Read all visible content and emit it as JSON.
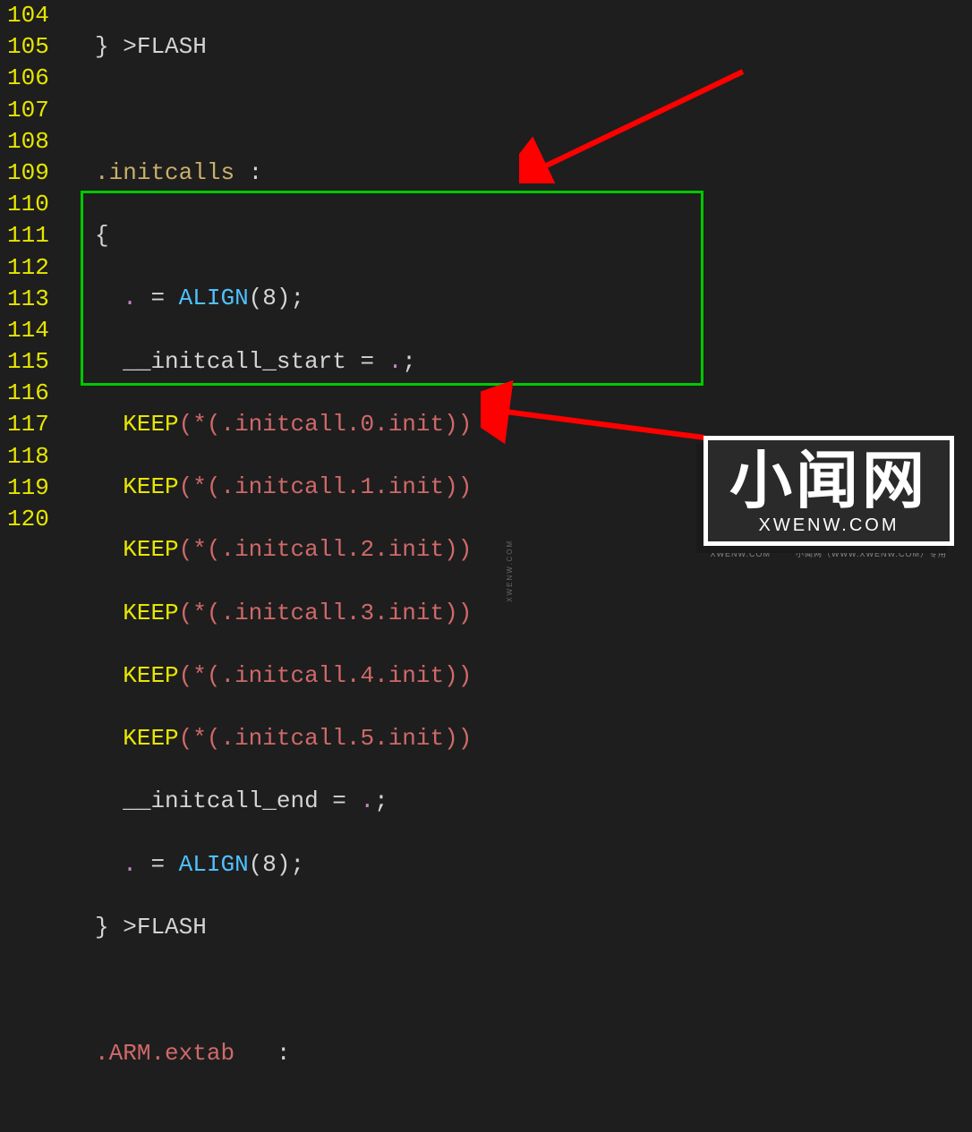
{
  "line_numbers": [
    "104",
    "105",
    "106",
    "107",
    "108",
    "109",
    "110",
    "111",
    "112",
    "113",
    "114",
    "115",
    "116",
    "117",
    "118",
    "119",
    "120"
  ],
  "code": {
    "l104_brace": "}",
    "l104_region": ">FLASH",
    "l106_section": ".initcalls",
    "l106_colon": ":",
    "l107_brace": "{",
    "l108_dot": ".",
    "l108_eq": " = ",
    "l108_align": "ALIGN",
    "l108_args": "(8);",
    "l109_sym": "__initcall_start",
    "l109_eq": " = ",
    "l109_dot": ".",
    "l109_semi": ";",
    "keep": "KEEP",
    "l110_arg": "(*(.initcall.0.init))",
    "l111_arg": "(*(.initcall.1.init))",
    "l112_arg": "(*(.initcall.2.init))",
    "l113_arg": "(*(.initcall.3.init))",
    "l114_arg": "(*(.initcall.4.init))",
    "l115_arg": "(*(.initcall.5.init))",
    "l116_sym": "__initcall_end",
    "l116_eq": " = ",
    "l116_dot": ".",
    "l116_semi": ";",
    "l117_dot": ".",
    "l117_eq": " = ",
    "l117_align": "ALIGN",
    "l117_args": "(8);",
    "l118_brace": "}",
    "l118_region": ">FLASH",
    "l120_section": ".ARM.extab",
    "l120_colon": ":"
  },
  "watermark": {
    "main": "小闻网",
    "sub": "XWENW.COM",
    "footer": "小闻网（WWW.XWENW.COM）专用",
    "side1": "XWENW.COM",
    "side2": "XWENW.COM"
  }
}
